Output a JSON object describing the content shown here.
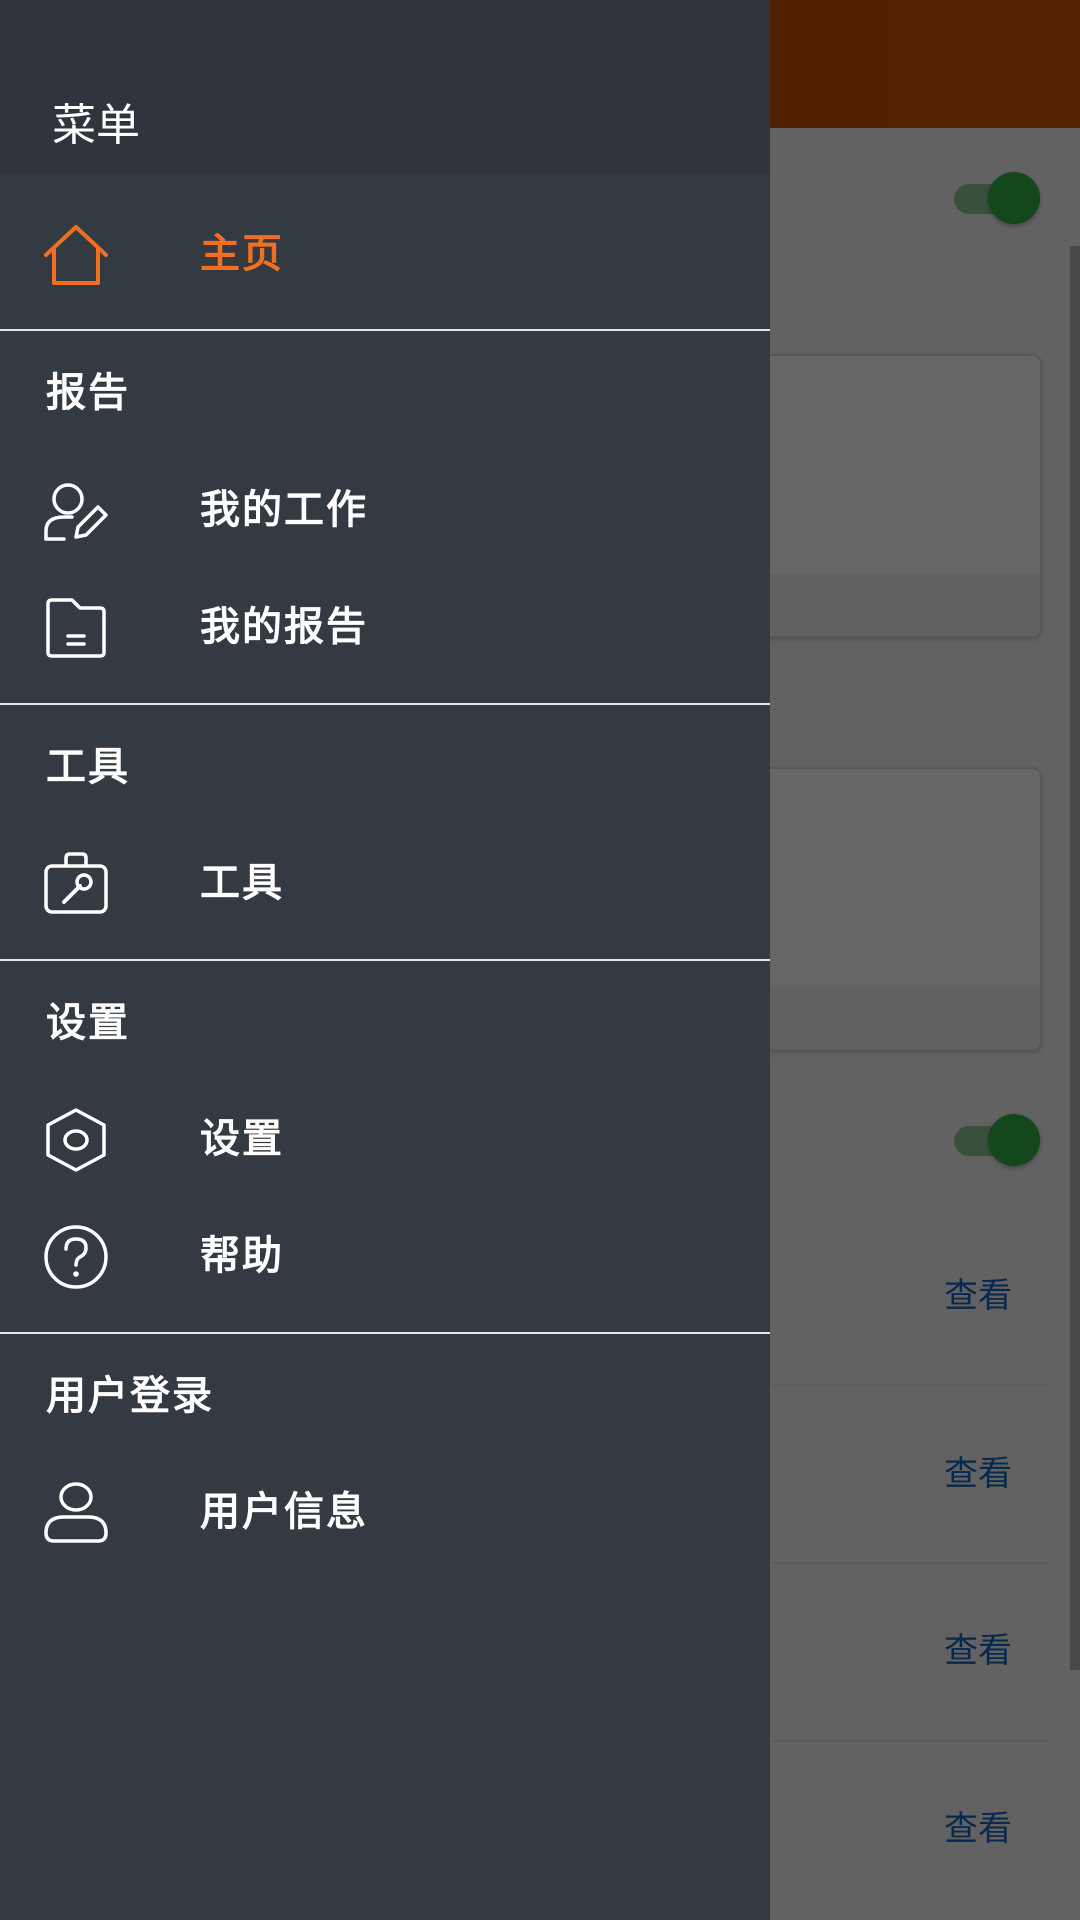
{
  "colors": {
    "accent": "#f26f21",
    "drawer_bg": "#343a42",
    "header_bar": "#d35400",
    "link": "#1565c0",
    "toggle_on": "#2fb344"
  },
  "drawer": {
    "title": "菜单",
    "home": {
      "label": "主页",
      "icon": "home-icon",
      "active": true
    },
    "sections": [
      {
        "title": "报告",
        "items": [
          {
            "label": "我的工作",
            "icon": "user-edit-icon"
          },
          {
            "label": "我的报告",
            "icon": "folder-document-icon"
          }
        ]
      },
      {
        "title": "工具",
        "items": [
          {
            "label": "工具",
            "icon": "toolbox-icon"
          }
        ]
      },
      {
        "title": "设置",
        "items": [
          {
            "label": "设置",
            "icon": "settings-hexagon-icon"
          },
          {
            "label": "帮助",
            "icon": "help-circle-icon"
          }
        ]
      },
      {
        "title": "用户登录",
        "items": [
          {
            "label": "用户信息",
            "icon": "user-icon"
          }
        ]
      }
    ]
  },
  "background": {
    "toggles": [
      {
        "on": true
      },
      {
        "on": true
      }
    ],
    "view_links": [
      "查看",
      "查看",
      "查看",
      "查看"
    ]
  }
}
